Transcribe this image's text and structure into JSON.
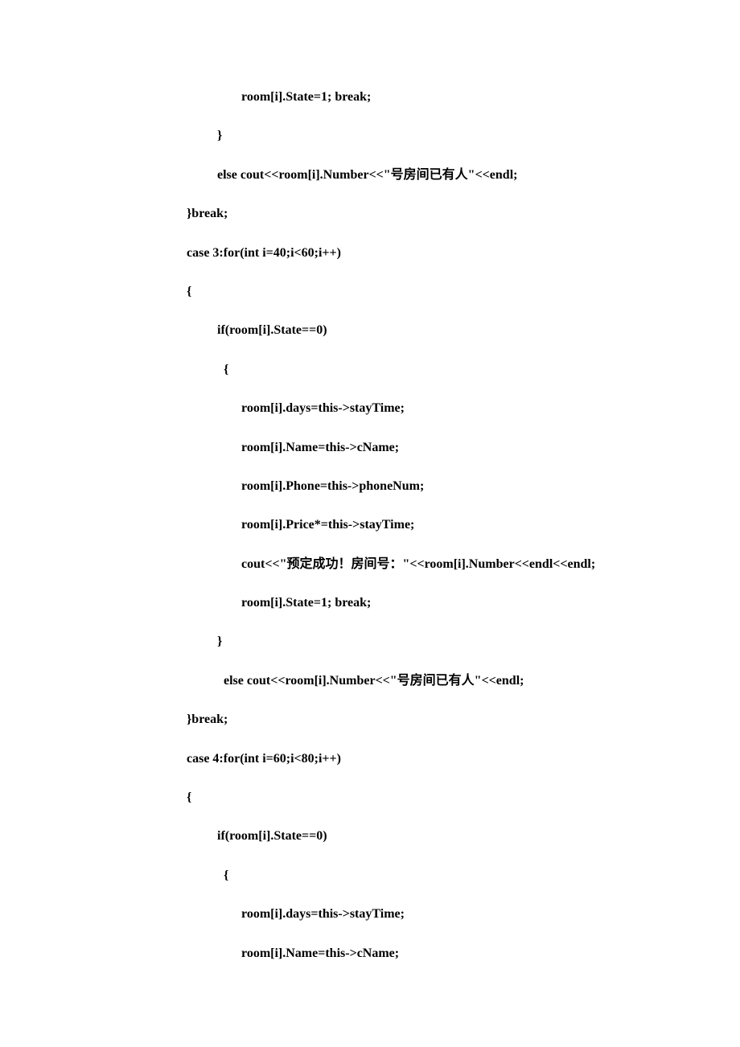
{
  "code_lines": [
    {
      "indent": "indent-3",
      "text": "room[i].State=1; break;"
    },
    {
      "indent": "indent-1",
      "text": "}"
    },
    {
      "indent": "indent-1",
      "text": "else cout<<room[i].Number<<\"号房间已有人\"<<endl;"
    },
    {
      "indent": "indent-base",
      "text": "}break;"
    },
    {
      "indent": "indent-base",
      "text": ""
    },
    {
      "indent": "indent-base",
      "text": "case 3:for(int i=40;i<60;i++)"
    },
    {
      "indent": "indent-base",
      "text": "{"
    },
    {
      "indent": "indent-1",
      "text": "if(room[i].State==0)"
    },
    {
      "indent": "indent-2",
      "text": "{"
    },
    {
      "indent": "indent-3",
      "text": "room[i].days=this->stayTime;"
    },
    {
      "indent": "indent-3",
      "text": "room[i].Name=this->cName;"
    },
    {
      "indent": "indent-3",
      "text": "room[i].Phone=this->phoneNum;"
    },
    {
      "indent": "indent-3",
      "text": "room[i].Price*=this->stayTime;"
    },
    {
      "indent": "indent-3",
      "text": "cout<<\"预定成功！房间号：\"<<room[i].Number<<endl<<endl;"
    },
    {
      "indent": "indent-3",
      "text": "room[i].State=1; break;"
    },
    {
      "indent": "indent-1",
      "text": "}"
    },
    {
      "indent": "indent-2",
      "text": "else cout<<room[i].Number<<\"号房间已有人\"<<endl;"
    },
    {
      "indent": "indent-base",
      "text": "}break;"
    },
    {
      "indent": "indent-base",
      "text": ""
    },
    {
      "indent": "indent-base",
      "text": "case 4:for(int i=60;i<80;i++)"
    },
    {
      "indent": "indent-base",
      "text": "{"
    },
    {
      "indent": "indent-1",
      "text": "if(room[i].State==0)"
    },
    {
      "indent": "indent-2",
      "text": "{"
    },
    {
      "indent": "indent-3",
      "text": "room[i].days=this->stayTime;"
    },
    {
      "indent": "indent-3",
      "text": "room[i].Name=this->cName;"
    }
  ]
}
